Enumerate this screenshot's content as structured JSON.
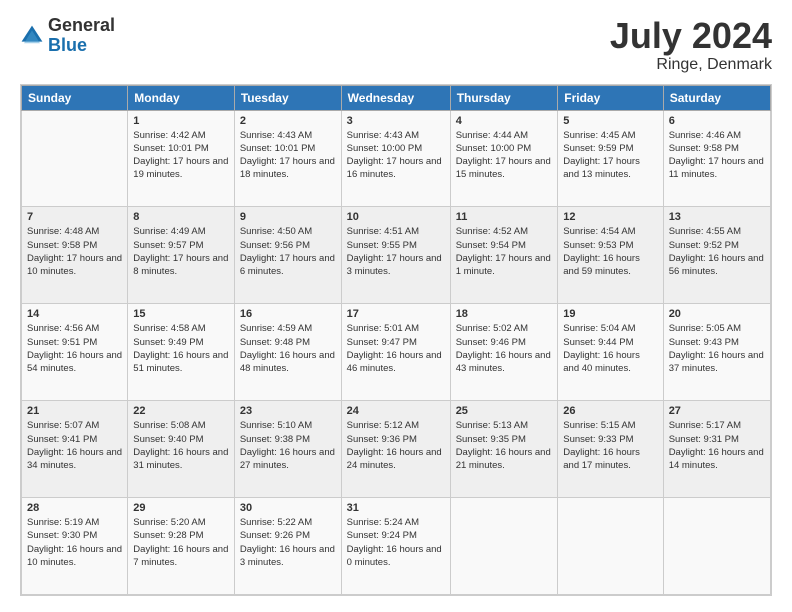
{
  "header": {
    "logo_general": "General",
    "logo_blue": "Blue",
    "month_title": "July 2024",
    "location": "Ringe, Denmark"
  },
  "days_of_week": [
    "Sunday",
    "Monday",
    "Tuesday",
    "Wednesday",
    "Thursday",
    "Friday",
    "Saturday"
  ],
  "weeks": [
    [
      {
        "day": "",
        "sunrise": "",
        "sunset": "",
        "daylight": ""
      },
      {
        "day": "1",
        "sunrise": "Sunrise: 4:42 AM",
        "sunset": "Sunset: 10:01 PM",
        "daylight": "Daylight: 17 hours and 19 minutes."
      },
      {
        "day": "2",
        "sunrise": "Sunrise: 4:43 AM",
        "sunset": "Sunset: 10:01 PM",
        "daylight": "Daylight: 17 hours and 18 minutes."
      },
      {
        "day": "3",
        "sunrise": "Sunrise: 4:43 AM",
        "sunset": "Sunset: 10:00 PM",
        "daylight": "Daylight: 17 hours and 16 minutes."
      },
      {
        "day": "4",
        "sunrise": "Sunrise: 4:44 AM",
        "sunset": "Sunset: 10:00 PM",
        "daylight": "Daylight: 17 hours and 15 minutes."
      },
      {
        "day": "5",
        "sunrise": "Sunrise: 4:45 AM",
        "sunset": "Sunset: 9:59 PM",
        "daylight": "Daylight: 17 hours and 13 minutes."
      },
      {
        "day": "6",
        "sunrise": "Sunrise: 4:46 AM",
        "sunset": "Sunset: 9:58 PM",
        "daylight": "Daylight: 17 hours and 11 minutes."
      }
    ],
    [
      {
        "day": "7",
        "sunrise": "Sunrise: 4:48 AM",
        "sunset": "Sunset: 9:58 PM",
        "daylight": "Daylight: 17 hours and 10 minutes."
      },
      {
        "day": "8",
        "sunrise": "Sunrise: 4:49 AM",
        "sunset": "Sunset: 9:57 PM",
        "daylight": "Daylight: 17 hours and 8 minutes."
      },
      {
        "day": "9",
        "sunrise": "Sunrise: 4:50 AM",
        "sunset": "Sunset: 9:56 PM",
        "daylight": "Daylight: 17 hours and 6 minutes."
      },
      {
        "day": "10",
        "sunrise": "Sunrise: 4:51 AM",
        "sunset": "Sunset: 9:55 PM",
        "daylight": "Daylight: 17 hours and 3 minutes."
      },
      {
        "day": "11",
        "sunrise": "Sunrise: 4:52 AM",
        "sunset": "Sunset: 9:54 PM",
        "daylight": "Daylight: 17 hours and 1 minute."
      },
      {
        "day": "12",
        "sunrise": "Sunrise: 4:54 AM",
        "sunset": "Sunset: 9:53 PM",
        "daylight": "Daylight: 16 hours and 59 minutes."
      },
      {
        "day": "13",
        "sunrise": "Sunrise: 4:55 AM",
        "sunset": "Sunset: 9:52 PM",
        "daylight": "Daylight: 16 hours and 56 minutes."
      }
    ],
    [
      {
        "day": "14",
        "sunrise": "Sunrise: 4:56 AM",
        "sunset": "Sunset: 9:51 PM",
        "daylight": "Daylight: 16 hours and 54 minutes."
      },
      {
        "day": "15",
        "sunrise": "Sunrise: 4:58 AM",
        "sunset": "Sunset: 9:49 PM",
        "daylight": "Daylight: 16 hours and 51 minutes."
      },
      {
        "day": "16",
        "sunrise": "Sunrise: 4:59 AM",
        "sunset": "Sunset: 9:48 PM",
        "daylight": "Daylight: 16 hours and 48 minutes."
      },
      {
        "day": "17",
        "sunrise": "Sunrise: 5:01 AM",
        "sunset": "Sunset: 9:47 PM",
        "daylight": "Daylight: 16 hours and 46 minutes."
      },
      {
        "day": "18",
        "sunrise": "Sunrise: 5:02 AM",
        "sunset": "Sunset: 9:46 PM",
        "daylight": "Daylight: 16 hours and 43 minutes."
      },
      {
        "day": "19",
        "sunrise": "Sunrise: 5:04 AM",
        "sunset": "Sunset: 9:44 PM",
        "daylight": "Daylight: 16 hours and 40 minutes."
      },
      {
        "day": "20",
        "sunrise": "Sunrise: 5:05 AM",
        "sunset": "Sunset: 9:43 PM",
        "daylight": "Daylight: 16 hours and 37 minutes."
      }
    ],
    [
      {
        "day": "21",
        "sunrise": "Sunrise: 5:07 AM",
        "sunset": "Sunset: 9:41 PM",
        "daylight": "Daylight: 16 hours and 34 minutes."
      },
      {
        "day": "22",
        "sunrise": "Sunrise: 5:08 AM",
        "sunset": "Sunset: 9:40 PM",
        "daylight": "Daylight: 16 hours and 31 minutes."
      },
      {
        "day": "23",
        "sunrise": "Sunrise: 5:10 AM",
        "sunset": "Sunset: 9:38 PM",
        "daylight": "Daylight: 16 hours and 27 minutes."
      },
      {
        "day": "24",
        "sunrise": "Sunrise: 5:12 AM",
        "sunset": "Sunset: 9:36 PM",
        "daylight": "Daylight: 16 hours and 24 minutes."
      },
      {
        "day": "25",
        "sunrise": "Sunrise: 5:13 AM",
        "sunset": "Sunset: 9:35 PM",
        "daylight": "Daylight: 16 hours and 21 minutes."
      },
      {
        "day": "26",
        "sunrise": "Sunrise: 5:15 AM",
        "sunset": "Sunset: 9:33 PM",
        "daylight": "Daylight: 16 hours and 17 minutes."
      },
      {
        "day": "27",
        "sunrise": "Sunrise: 5:17 AM",
        "sunset": "Sunset: 9:31 PM",
        "daylight": "Daylight: 16 hours and 14 minutes."
      }
    ],
    [
      {
        "day": "28",
        "sunrise": "Sunrise: 5:19 AM",
        "sunset": "Sunset: 9:30 PM",
        "daylight": "Daylight: 16 hours and 10 minutes."
      },
      {
        "day": "29",
        "sunrise": "Sunrise: 5:20 AM",
        "sunset": "Sunset: 9:28 PM",
        "daylight": "Daylight: 16 hours and 7 minutes."
      },
      {
        "day": "30",
        "sunrise": "Sunrise: 5:22 AM",
        "sunset": "Sunset: 9:26 PM",
        "daylight": "Daylight: 16 hours and 3 minutes."
      },
      {
        "day": "31",
        "sunrise": "Sunrise: 5:24 AM",
        "sunset": "Sunset: 9:24 PM",
        "daylight": "Daylight: 16 hours and 0 minutes."
      },
      {
        "day": "",
        "sunrise": "",
        "sunset": "",
        "daylight": ""
      },
      {
        "day": "",
        "sunrise": "",
        "sunset": "",
        "daylight": ""
      },
      {
        "day": "",
        "sunrise": "",
        "sunset": "",
        "daylight": ""
      }
    ]
  ]
}
